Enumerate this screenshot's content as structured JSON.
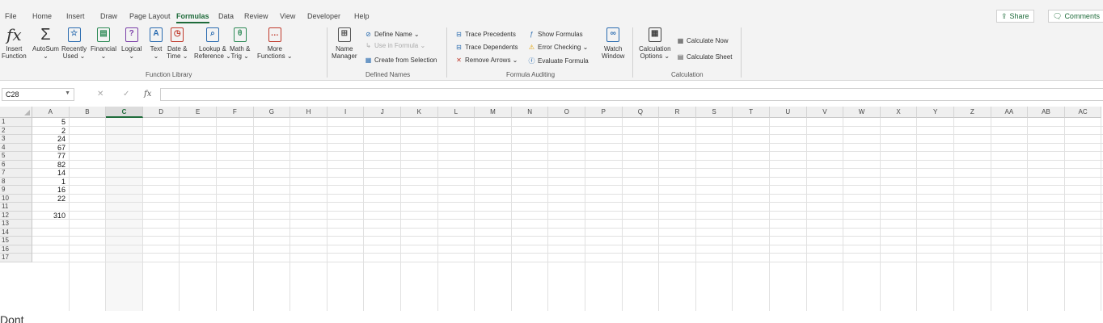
{
  "menu": {
    "tabs": [
      "File",
      "Home",
      "Insert",
      "Draw",
      "Page Layout",
      "Formulas",
      "Data",
      "Review",
      "View",
      "Developer",
      "Help"
    ],
    "active_tab": "Formulas",
    "share_label": "Share",
    "comments_label": "Comments"
  },
  "ribbon": {
    "function_library": {
      "label": "Function Library",
      "insert_function": [
        "Insert",
        "Function"
      ],
      "autosum": [
        "AutoSum",
        "⌄"
      ],
      "recently_used": [
        "Recently",
        "Used ⌄"
      ],
      "financial": [
        "Financial",
        "⌄"
      ],
      "logical": [
        "Logical",
        "⌄"
      ],
      "text": [
        "Text",
        "⌄"
      ],
      "date_time": [
        "Date &",
        "Time ⌄"
      ],
      "lookup_reference": [
        "Lookup &",
        "Reference ⌄"
      ],
      "math_trig": [
        "Math &",
        "Trig ⌄"
      ],
      "more_functions": [
        "More",
        "Functions ⌄"
      ]
    },
    "defined_names": {
      "label": "Defined Names",
      "name_manager": [
        "Name",
        "Manager"
      ],
      "define_name": "Define Name ⌄",
      "use_in_formula": "Use in Formula ⌄",
      "create_from_selection": "Create from Selection"
    },
    "formula_auditing": {
      "label": "Formula Auditing",
      "trace_precedents": "Trace Precedents",
      "trace_dependents": "Trace Dependents",
      "remove_arrows": "Remove Arrows ⌄",
      "show_formulas": "Show Formulas",
      "error_checking": "Error Checking ⌄",
      "evaluate_formula": "Evaluate Formula",
      "watch_window": [
        "Watch",
        "Window"
      ]
    },
    "calculation": {
      "label": "Calculation",
      "calculation_options": [
        "Calculation",
        "Options ⌄"
      ],
      "calculate_now": "Calculate Now",
      "calculate_sheet": "Calculate Sheet"
    }
  },
  "formula_bar": {
    "name_box": "C28",
    "formula": ""
  },
  "sheet": {
    "columns": [
      "A",
      "B",
      "C",
      "D",
      "E",
      "F",
      "G",
      "H",
      "I",
      "J",
      "K",
      "L",
      "M",
      "N",
      "O",
      "P",
      "Q",
      "R",
      "S",
      "T",
      "U",
      "V",
      "W",
      "X",
      "Y",
      "Z",
      "AA",
      "AB",
      "AC"
    ],
    "rows": [
      "1",
      "2",
      "3",
      "4",
      "5",
      "6",
      "7",
      "8",
      "9",
      "10",
      "11",
      "12",
      "13",
      "14",
      "15",
      "16",
      "17"
    ],
    "selected_column": "C",
    "column_a_values": [
      "5",
      "2",
      "24",
      "67",
      "77",
      "82",
      "14",
      "1",
      "16",
      "22",
      "",
      "310",
      "",
      "",
      "",
      "",
      ""
    ]
  },
  "footer_cutoff_text": "Dont"
}
